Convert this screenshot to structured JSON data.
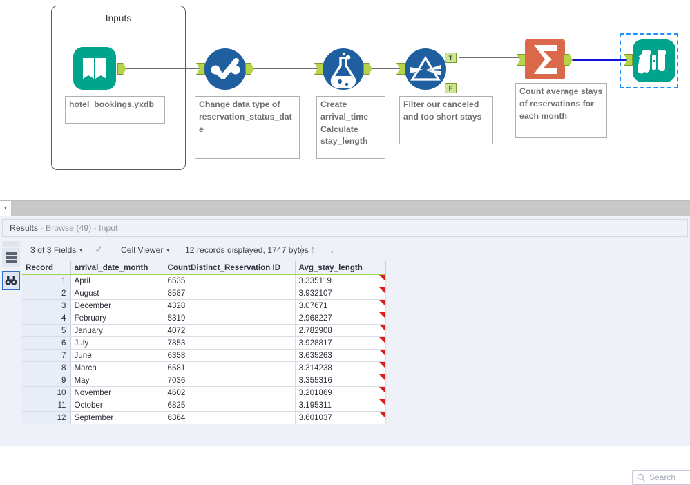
{
  "canvas": {
    "container": {
      "title": "Inputs"
    },
    "nodes": [
      {
        "id": "input-tool",
        "icon": "book-open-icon",
        "annotation": "hotel_bookings.yxdb"
      },
      {
        "id": "select-tool",
        "icon": "check-select-icon",
        "annotation": "Change data type of reservation_status_date"
      },
      {
        "id": "formula-tool",
        "icon": "flask-icon",
        "annotation": "Create arrival_time Calculate stay_length"
      },
      {
        "id": "filter-tool",
        "icon": "prism-filter-icon",
        "annotation": "Filter our canceled and too short stays",
        "output_true": "T",
        "output_false": "F"
      },
      {
        "id": "summarize-tool",
        "icon": "sigma-icon",
        "annotation": "Count average stays of reservations for each month"
      },
      {
        "id": "browse-tool",
        "icon": "binoculars-icon",
        "annotation": "",
        "selected": true
      }
    ],
    "colors": {
      "input_teal": "#00a38c",
      "tool_blue": "#1f5fa0",
      "summarize_orange": "#d9694a",
      "anchor_green": "#b5d44a",
      "selection_blue": "#1e90ff",
      "wire_selected": "#1414e0"
    }
  },
  "splitter": {
    "collapse_glyph": "‹"
  },
  "results": {
    "tab": {
      "prefix": "Results",
      "suffix": " - Browse (49) - Input"
    },
    "toolbar": {
      "fields_label": "3 of 3 Fields",
      "caret": "▾",
      "check_glyph": "✓",
      "viewer_label": "Cell Viewer",
      "records_label": "12 records displayed, 1747 bytes",
      "up_glyph": "↑",
      "down_glyph": "↓"
    },
    "search": {
      "placeholder": "Search",
      "icon": "search-icon"
    },
    "rail": {
      "grip": "·····",
      "items": [
        {
          "name": "rows-view-icon"
        },
        {
          "name": "browse-binoculars-icon",
          "selected": true
        }
      ]
    },
    "table": {
      "columns": [
        "Record",
        "arrival_date_month",
        "CountDistinct_Reservation ID",
        "Avg_stay_length"
      ],
      "rows": [
        [
          "1",
          "April",
          "6535",
          "3.335119"
        ],
        [
          "2",
          "August",
          "8587",
          "3.932107"
        ],
        [
          "3",
          "December",
          "4328",
          "3.07671"
        ],
        [
          "4",
          "February",
          "5319",
          "2.968227"
        ],
        [
          "5",
          "January",
          "4072",
          "2.782908"
        ],
        [
          "6",
          "July",
          "7853",
          "3.928817"
        ],
        [
          "7",
          "June",
          "6358",
          "3.635263"
        ],
        [
          "8",
          "March",
          "6581",
          "3.314238"
        ],
        [
          "9",
          "May",
          "7036",
          "3.355316"
        ],
        [
          "10",
          "November",
          "4602",
          "3.201869"
        ],
        [
          "11",
          "October",
          "6825",
          "3.195311"
        ],
        [
          "12",
          "September",
          "6364",
          "3.601037"
        ]
      ]
    }
  }
}
